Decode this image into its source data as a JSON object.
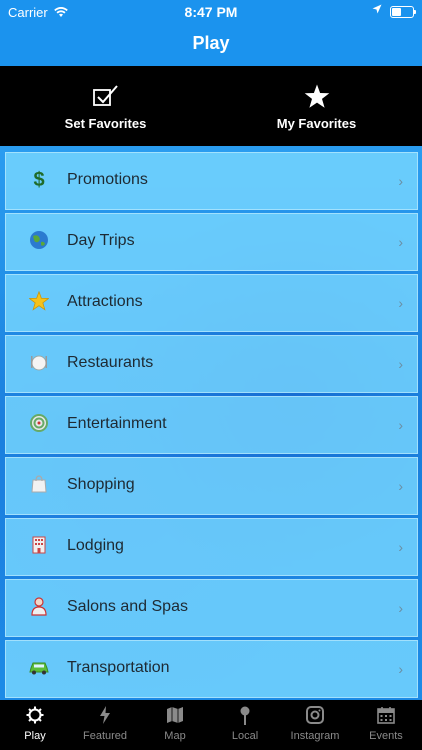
{
  "status_bar": {
    "carrier": "Carrier",
    "time": "8:47 PM"
  },
  "nav": {
    "title": "Play"
  },
  "favorites": {
    "set_label": "Set Favorites",
    "my_label": "My Favorites"
  },
  "list": [
    {
      "label": "Promotions",
      "icon": "dollar-icon"
    },
    {
      "label": "Day Trips",
      "icon": "globe-icon"
    },
    {
      "label": "Attractions",
      "icon": "star-icon"
    },
    {
      "label": "Restaurants",
      "icon": "plate-icon"
    },
    {
      "label": "Entertainment",
      "icon": "target-icon"
    },
    {
      "label": "Shopping",
      "icon": "shopping-bag-icon"
    },
    {
      "label": "Lodging",
      "icon": "hotel-icon"
    },
    {
      "label": "Salons and Spas",
      "icon": "person-icon"
    },
    {
      "label": "Transportation",
      "icon": "car-icon"
    }
  ],
  "tabs": [
    {
      "label": "Play",
      "icon": "gear-icon",
      "active": true
    },
    {
      "label": "Featured",
      "icon": "lightning-icon"
    },
    {
      "label": "Map",
      "icon": "map-icon"
    },
    {
      "label": "Local",
      "icon": "pin-icon"
    },
    {
      "label": "Instagram",
      "icon": "instagram-icon"
    },
    {
      "label": "Events",
      "icon": "calendar-icon"
    }
  ],
  "colors": {
    "nav_blue": "#1b93ee",
    "row_fill": "#78d7ff",
    "tab_active": "#ffffff",
    "tab_inactive": "#8a8a8a"
  }
}
